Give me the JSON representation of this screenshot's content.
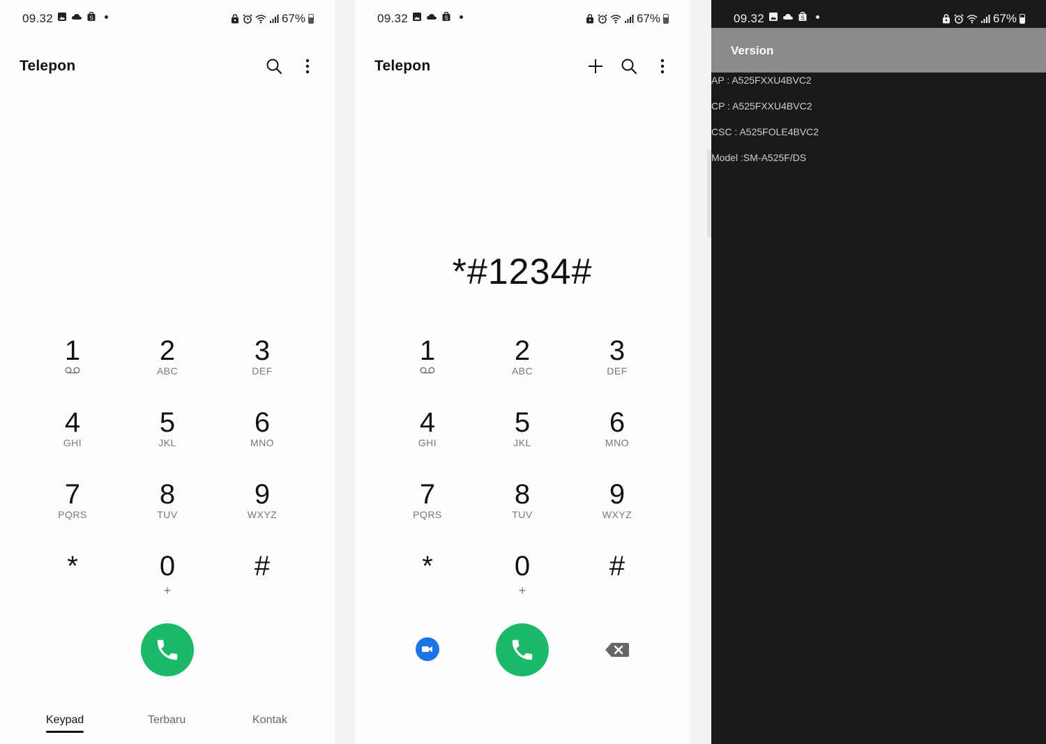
{
  "status_bar": {
    "time": "09.32",
    "battery": "67%",
    "battery_level": 0.67
  },
  "dialer": {
    "title": "Telepon",
    "dialed_number": "*#1234#",
    "keys": [
      {
        "digit": "1",
        "letters": ""
      },
      {
        "digit": "2",
        "letters": "ABC"
      },
      {
        "digit": "3",
        "letters": "DEF"
      },
      {
        "digit": "4",
        "letters": "GHI"
      },
      {
        "digit": "5",
        "letters": "JKL"
      },
      {
        "digit": "6",
        "letters": "MNO"
      },
      {
        "digit": "7",
        "letters": "PQRS"
      },
      {
        "digit": "8",
        "letters": "TUV"
      },
      {
        "digit": "9",
        "letters": "WXYZ"
      },
      {
        "digit": "*",
        "letters": ""
      },
      {
        "digit": "0",
        "letters": "+"
      },
      {
        "digit": "#",
        "letters": ""
      }
    ],
    "tabs": [
      "Keypad",
      "Terbaru",
      "Kontak"
    ],
    "active_tab": "Keypad"
  },
  "version_screen": {
    "title": "Version",
    "rows": [
      "AP : A525FXXU4BVC2",
      "CP : A525FXXU4BVC2",
      "CSC : A525FOLE4BVC2",
      "Model :SM-A525F/DS"
    ]
  },
  "colors": {
    "call_green": "#1cb96b",
    "video_blue": "#1e73e8",
    "header_gray": "#8a8a8a",
    "dark_bg": "#1a1a1a"
  }
}
